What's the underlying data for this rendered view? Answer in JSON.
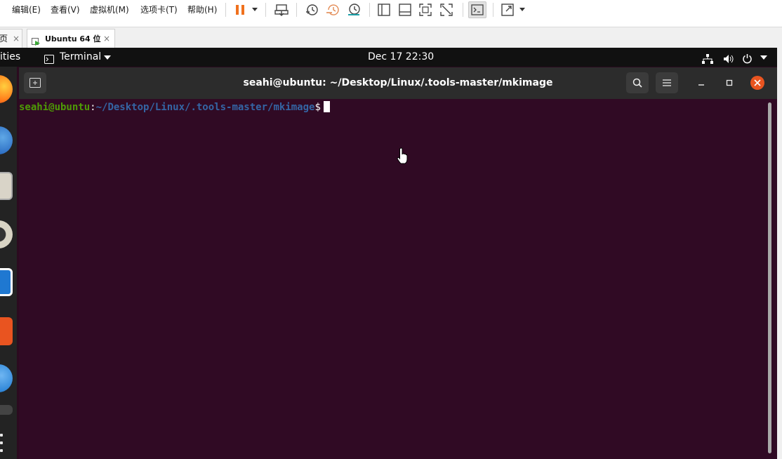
{
  "vm": {
    "menu": {
      "edit": "编辑(E)",
      "view": "查看(V)",
      "vm": "虚拟机(M)",
      "tabs": "选项卡(T)",
      "help": "帮助(H)"
    },
    "toolbar_icons": [
      "pause-icon",
      "send-ctrl-alt-del-icon",
      "snapshot-icon",
      "revert-snapshot-icon",
      "snapshot-manager-icon",
      "sidebar-icon",
      "console-view-icon",
      "fullscreen-icon",
      "unity-icon",
      "terminal-icon",
      "stretch-icon"
    ],
    "tabs": [
      {
        "label": "页",
        "close": "×"
      },
      {
        "label": "Ubuntu 64 位",
        "close": "×"
      }
    ]
  },
  "ubuntu": {
    "topbar": {
      "activities": "ities",
      "app_menu": "Terminal",
      "clock": "Dec 17  22:30"
    }
  },
  "terminal": {
    "title": "seahi@ubuntu: ~/Desktop/Linux/.tools-master/mkimage",
    "prompt_user": "seahi@ubuntu",
    "prompt_colon": ":",
    "prompt_path": "~/Desktop/Linux/.tools-master/mkimage",
    "prompt_symbol": "$"
  },
  "colors": {
    "terminal_bg": "#300a24",
    "prompt_user": "#4e9a06",
    "prompt_path": "#3465a4",
    "close_button": "#e95420",
    "pause_orange": "#f0711e"
  }
}
